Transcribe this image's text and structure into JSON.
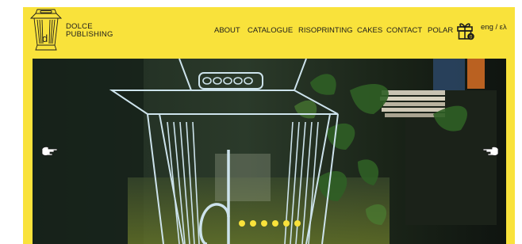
{
  "brand": {
    "name_line1": "DOLCE",
    "name_line2": "PUBLISHING",
    "accent_color": "#f9e23b"
  },
  "nav": {
    "items": [
      {
        "label": "ABOUT"
      },
      {
        "label": "CATALOGUE"
      },
      {
        "label": "RISOPRINTING"
      },
      {
        "label": "CAKES"
      },
      {
        "label": "CONTACT"
      },
      {
        "label": "POLAR"
      }
    ],
    "cart_icon": "gift-icon",
    "cart_count": "0",
    "language_switch": "eng / ελ"
  },
  "carousel": {
    "prev_icon": "pointing-hand-left-icon",
    "next_icon": "pointing-hand-right-icon",
    "slide_count": 6,
    "slide_letter": "d"
  }
}
